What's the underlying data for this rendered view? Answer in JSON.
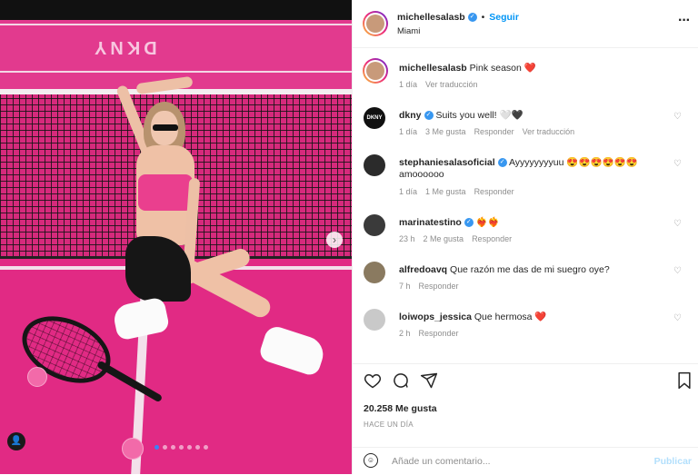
{
  "post": {
    "author": "michellesalasb",
    "location": "Miami",
    "follow_label": "Seguir",
    "caption_user": "michellesalasb",
    "caption_text": "Pink season ❤️",
    "caption_time": "1 día",
    "caption_translate": "Ver traducción",
    "image_brand": "DKNY",
    "carousel_total": 7,
    "carousel_active": 1
  },
  "comments": [
    {
      "user": "dkny",
      "verified": true,
      "text": "Suits you well! 🤍🖤",
      "time": "1 día",
      "likes": "3 Me gusta",
      "reply": "Responder",
      "translate": "Ver traducción",
      "avatar_color": "#111111"
    },
    {
      "user": "stephaniesalasoficial",
      "verified": true,
      "text": "Ayyyyyyyyuu 😍😍😍😍😍😍 amoooooo",
      "time": "1 día",
      "likes": "1 Me gusta",
      "reply": "Responder",
      "avatar_color": "#2b2b2b"
    },
    {
      "user": "marinatestino",
      "verified": true,
      "text": "❤️‍🔥❤️‍🔥",
      "time": "23 h",
      "likes": "2 Me gusta",
      "reply": "Responder",
      "avatar_color": "#3a3a3a"
    },
    {
      "user": "alfredoavq",
      "verified": false,
      "text": "Que razón me das de mi suegro oye?",
      "time": "7 h",
      "reply": "Responder",
      "avatar_color": "#8a7a60"
    },
    {
      "user": "loiwops_jessica",
      "verified": false,
      "text": "Que hermosa ❤️",
      "time": "2 h",
      "reply": "Responder",
      "avatar_color": "#c9c9c9"
    }
  ],
  "actions": {
    "likes": "20.258 Me gusta",
    "timestamp": "HACE UN DÍA"
  },
  "add_comment": {
    "placeholder": "Añade un comentario...",
    "publish": "Publicar"
  },
  "icons": {
    "more": "more-icon",
    "like": "heart-icon",
    "comment": "comment-icon",
    "share": "send-icon",
    "save": "bookmark-icon",
    "emoji": "emoji-icon",
    "next": "chevron-right-icon",
    "tag": "user-tag-icon"
  },
  "colors": {
    "accent": "#0095f6",
    "verified": "#3897f0",
    "court_pink": "#e0237f",
    "muted": "#8e8e8e"
  }
}
